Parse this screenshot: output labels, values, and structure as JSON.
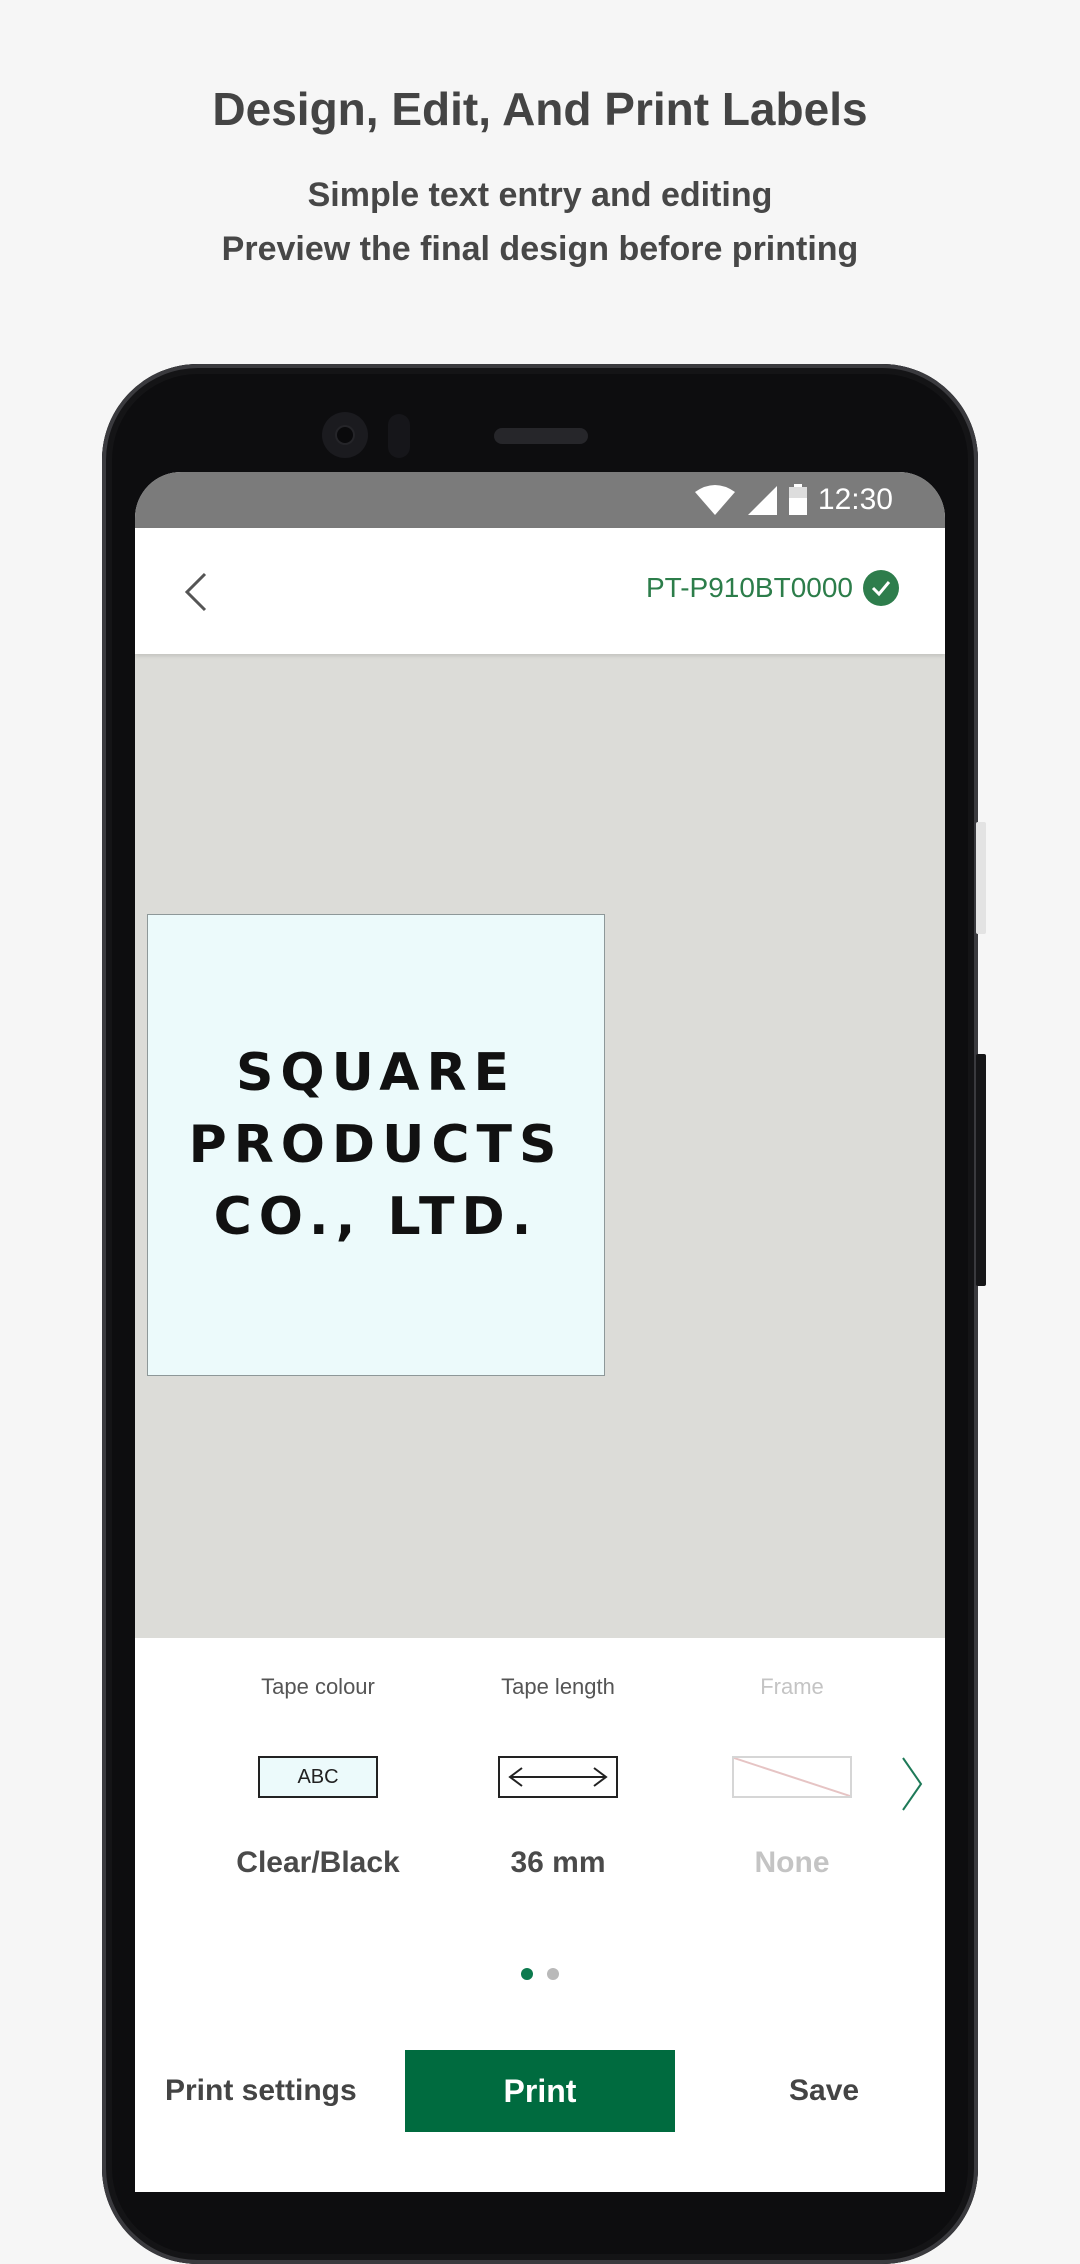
{
  "header": {
    "title": "Design, Edit, And Print Labels",
    "subtitle_1": "Simple text entry and editing",
    "subtitle_2": "Preview the final design before printing"
  },
  "status_bar": {
    "time": "12:30",
    "icons": [
      "wifi-icon",
      "signal-icon",
      "battery-icon"
    ]
  },
  "app_bar": {
    "back_icon": "chevron-left-icon",
    "printer_name": "PT-P910BT0000",
    "printer_status_icon": "check-circle-icon",
    "accent_color": "#2c7d4a"
  },
  "label": {
    "lines": [
      "SQUARE",
      "PRODUCTS",
      "CO., LTD."
    ],
    "tape_color": "#ecfafb"
  },
  "options": [
    {
      "title": "Tape colour",
      "icon_text": "ABC",
      "value": "Clear/Black",
      "enabled": true
    },
    {
      "title": "Tape length",
      "icon": "double-arrow-icon",
      "value": "36 mm",
      "enabled": true
    },
    {
      "title": "Frame",
      "icon": "no-frame-icon",
      "value": "None",
      "enabled": false
    }
  ],
  "pagination": {
    "pages": 2,
    "active": 1
  },
  "actions": {
    "print_settings": "Print settings",
    "print": "Print",
    "save": "Save",
    "primary_color": "#006b3f"
  }
}
